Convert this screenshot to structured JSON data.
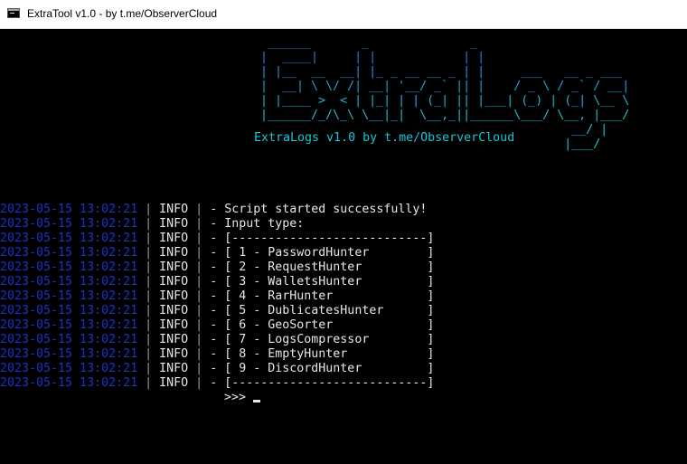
{
  "window": {
    "title": "ExtraTool v1.0 - by t.me/ObserverCloud",
    "app_icon": "console-window-icon"
  },
  "banner": {
    "ascii_lines": [
      "  ______       _              _                    ",
      " |  ____|     | |            | |                   ",
      " | |__  __  __| |_ _ __ __ _ | |     ___   __ _ ___",
      " |  __| \\ \\/ /| __| '__/ _` || |    / _ \\ / _` / __|",
      " | |____ >  < | |_| | | (_| || |___| (_) | (_| \\__ \\",
      " |______/_/\\_\\ \\__|_|  \\__,_||______\\___/ \\__, |___/",
      "                                            __/ |",
      "                                           |___/"
    ],
    "subtitle": "ExtraLogs v1.0 by t.me/ObserverCloud",
    "colors": [
      "#2b6fd6",
      "#19c6d4"
    ]
  },
  "log": [
    {
      "time": "2023-05-15 13:02:21",
      "level": "INFO",
      "message": "Script started successfully!"
    },
    {
      "time": "2023-05-15 13:02:21",
      "level": "INFO",
      "message": "Input type:"
    },
    {
      "time": "2023-05-15 13:02:21",
      "level": "INFO",
      "message": "[---------------------------]"
    },
    {
      "time": "2023-05-15 13:02:21",
      "level": "INFO",
      "message": "[ 1 - PasswordHunter        ]"
    },
    {
      "time": "2023-05-15 13:02:21",
      "level": "INFO",
      "message": "[ 2 - RequestHunter         ]"
    },
    {
      "time": "2023-05-15 13:02:21",
      "level": "INFO",
      "message": "[ 3 - WalletsHunter         ]"
    },
    {
      "time": "2023-05-15 13:02:21",
      "level": "INFO",
      "message": "[ 4 - RarHunter             ]"
    },
    {
      "time": "2023-05-15 13:02:21",
      "level": "INFO",
      "message": "[ 5 - DublicatesHunter      ]"
    },
    {
      "time": "2023-05-15 13:02:21",
      "level": "INFO",
      "message": "[ 6 - GeoSorter             ]"
    },
    {
      "time": "2023-05-15 13:02:21",
      "level": "INFO",
      "message": "[ 7 - LogsCompressor        ]"
    },
    {
      "time": "2023-05-15 13:02:21",
      "level": "INFO",
      "message": "[ 8 - EmptyHunter           ]"
    },
    {
      "time": "2023-05-15 13:02:21",
      "level": "INFO",
      "message": "[ 9 - DiscordHunter         ]"
    },
    {
      "time": "2023-05-15 13:02:21",
      "level": "INFO",
      "message": "[---------------------------]"
    }
  ],
  "prompt": ">>>",
  "colors": {
    "timestamp": "#1f32c8",
    "text": "#e6e6e6",
    "background": "#000000"
  }
}
